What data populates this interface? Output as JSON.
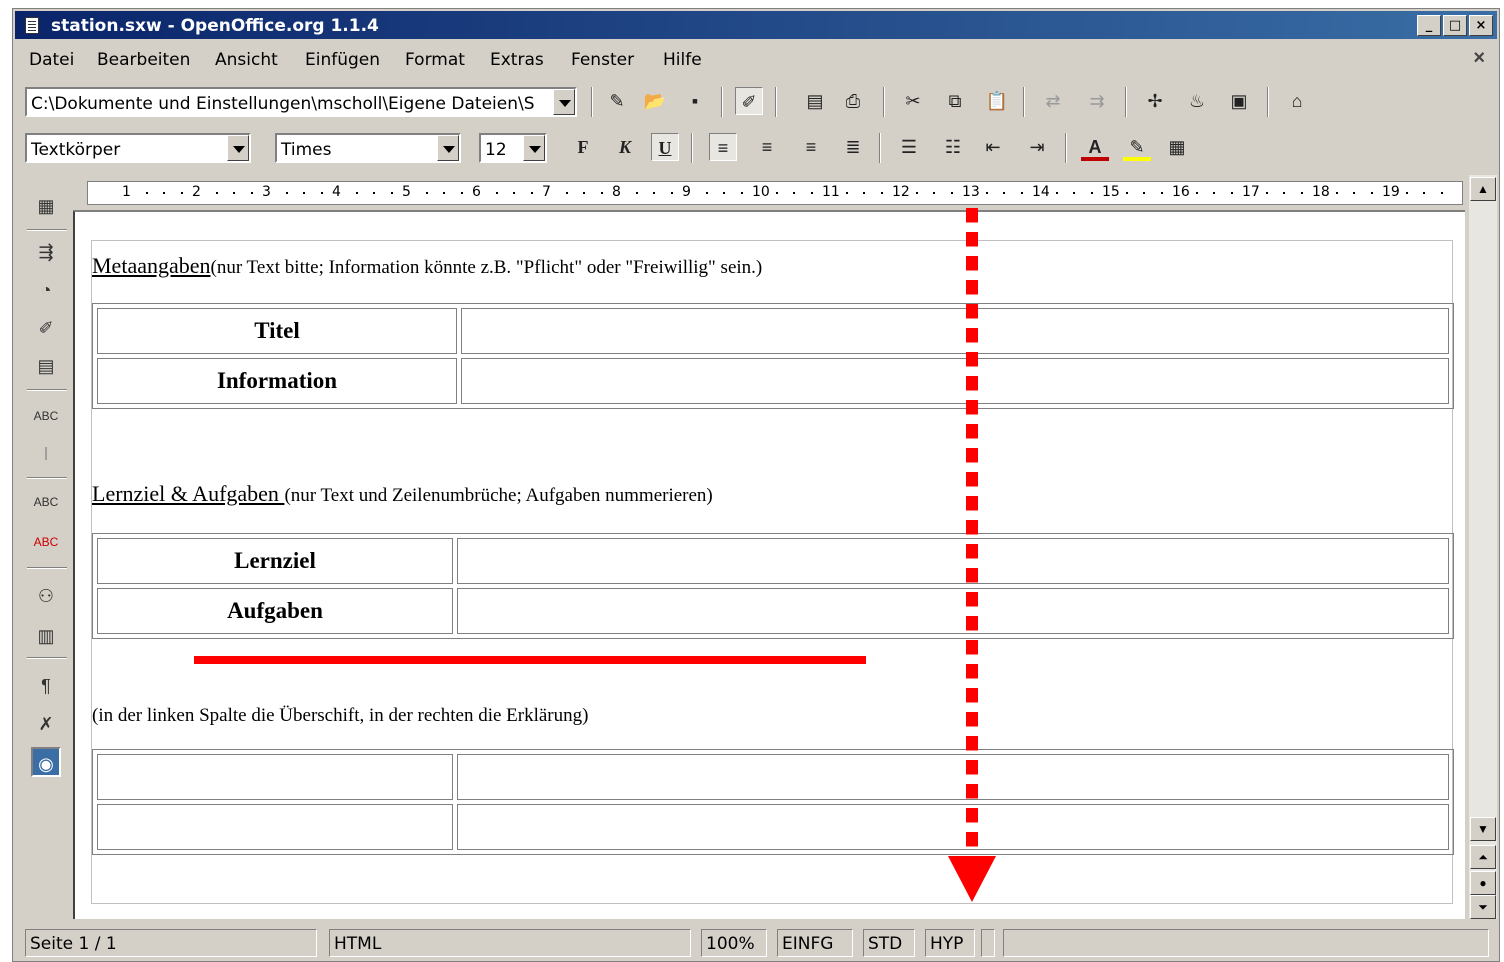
{
  "window": {
    "title": "station.sxw - OpenOffice.org 1.1.4"
  },
  "caption_buttons": {
    "minimize": "_",
    "maximize": "□",
    "close": "×"
  },
  "menu": {
    "items": [
      "Datei",
      "Bearbeiten",
      "Ansicht",
      "Einfügen",
      "Format",
      "Extras",
      "Fenster",
      "Hilfe"
    ],
    "close_doc": "×"
  },
  "function_bar": {
    "url_value": "C:\\Dokumente und Einstellungen\\mscholl\\Eigene Dateien\\S"
  },
  "object_bar": {
    "paragraph_style": "Textkörper",
    "font_name": "Times",
    "font_size": "12",
    "bold_label": "F",
    "italic_label": "K",
    "underline_label": "U"
  },
  "ruler": {
    "marks": [
      "1",
      "2",
      "3",
      "4",
      "5",
      "6",
      "7",
      "8",
      "9",
      "10",
      "11",
      "12",
      "13",
      "14",
      "15",
      "16",
      "17",
      "18",
      "19"
    ]
  },
  "document": {
    "section1": {
      "title": "Metaangaben",
      "note": "(nur Text bitte; Information könnte  z.B. \"Pflicht\"  oder \"Freiwillig\"  sein.)",
      "rows": [
        {
          "label": "Titel",
          "value": ""
        },
        {
          "label": "Information",
          "value": ""
        }
      ]
    },
    "section2": {
      "title": "Lernziel & Aufgaben ",
      "note": "(nur Text und Zeilenumbrüche; Aufgaben nummerieren)",
      "rows": [
        {
          "label": "Lernziel",
          "value": ""
        },
        {
          "label": "Aufgaben",
          "value": ""
        }
      ]
    },
    "section3": {
      "note": "(in der linken Spalte die Überschift, in der rechten die Erklärung)",
      "rows": [
        {
          "label": "",
          "value": ""
        },
        {
          "label": "",
          "value": ""
        }
      ]
    }
  },
  "status": {
    "page": "Seite 1 / 1",
    "style": "HTML",
    "zoom": "100%",
    "insert_mode": "EINFG",
    "selection_mode": "STD",
    "hyperlink_mode": "HYP"
  },
  "annotation_color": "#ff0000"
}
